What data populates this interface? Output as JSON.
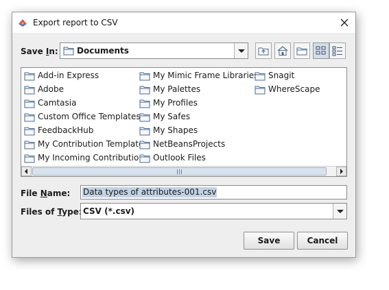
{
  "window": {
    "title": "Export report to CSV"
  },
  "save_in": {
    "label_prefix": "Save ",
    "label_mnemonic": "I",
    "label_suffix": "n:",
    "value": "Documents"
  },
  "toolbar": [
    {
      "name": "up-one-level-icon"
    },
    {
      "name": "home-icon"
    },
    {
      "name": "new-folder-icon"
    },
    {
      "name": "list-view-icon",
      "active": true
    },
    {
      "name": "details-view-icon"
    }
  ],
  "files": [
    "Add-in Express",
    "Adobe",
    "Camtasia",
    "Custom Office Templates",
    "FeedbackHub",
    "My Contribution Templates",
    "My Incoming Contributions",
    "My Mimic Frame Libraries",
    "My Palettes",
    "My Profiles",
    "My Safes",
    "My Shapes",
    "NetBeansProjects",
    "Outlook Files",
    "Snagit",
    "WhereScape"
  ],
  "file_name": {
    "label_prefix": "File ",
    "label_mnemonic": "N",
    "label_suffix": "ame:",
    "value": "Data types of attributes-001.csv"
  },
  "file_type": {
    "label_prefix": "Files of ",
    "label_mnemonic": "T",
    "label_suffix": "ype:",
    "value": "CSV (*.csv)"
  },
  "buttons": {
    "save": "Save",
    "cancel": "Cancel"
  },
  "colors": {
    "dialog_bg": "#eeeeee",
    "selection": "#c3d3e6",
    "folder": "#4a6a8f"
  }
}
